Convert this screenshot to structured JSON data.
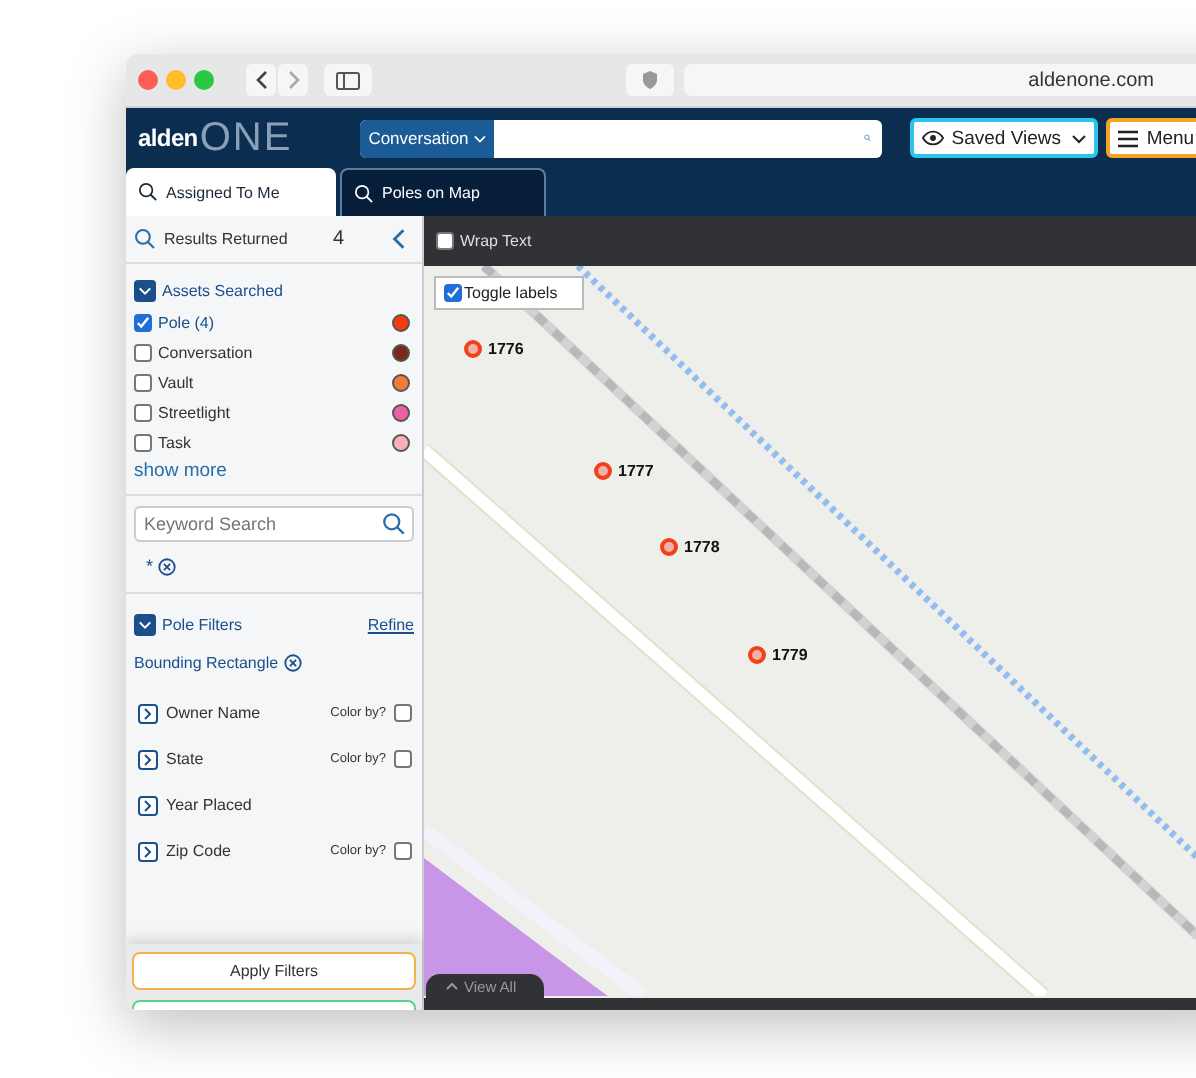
{
  "browser": {
    "url": "aldenone.com"
  },
  "header": {
    "logo": {
      "part_1": "alden",
      "part_2": "ONE"
    },
    "search": {
      "scope": "Conversation"
    },
    "saved_views": "Saved Views",
    "menu": "Menu"
  },
  "tabs": [
    {
      "label": "Assigned To Me",
      "selected": true
    },
    {
      "label": "Poles on Map",
      "selected": false
    }
  ],
  "sidebar": {
    "results": {
      "label": "Results Returned",
      "count": "4"
    },
    "assets": {
      "title": "Assets Searched",
      "expanded": true,
      "items": [
        {
          "label": "Pole (4)",
          "checked": true,
          "color": "#f23c0f"
        },
        {
          "label": "Conversation",
          "checked": false,
          "color": "#7a2a1a"
        },
        {
          "label": "Vault",
          "checked": false,
          "color": "#f07c38"
        },
        {
          "label": "Streetlight",
          "checked": false,
          "color": "#ee5fa3"
        },
        {
          "label": "Task",
          "checked": false,
          "color": "#f6b1b8"
        }
      ],
      "show_more": "show more"
    },
    "keyword_search": {
      "placeholder": "Keyword Search",
      "chip": "*"
    },
    "pole_filters": {
      "title": "Pole Filters",
      "expanded": true,
      "refine": "Refine",
      "bounding": "Bounding Rectangle",
      "filters": [
        {
          "label": "Owner Name",
          "color_by": "Color by?",
          "color_by_checked": false
        },
        {
          "label": "State",
          "color_by": "Color by?",
          "color_by_checked": false
        },
        {
          "label": "Year Placed"
        },
        {
          "label": "Zip Code",
          "color_by": "Color by?",
          "color_by_checked": false
        }
      ]
    },
    "apply": "Apply Filters"
  },
  "map": {
    "wrap_text": {
      "label": "Wrap Text",
      "checked": false
    },
    "toggle_labels": {
      "label": "Toggle labels",
      "checked": true
    },
    "markers": [
      {
        "label": "1776"
      },
      {
        "label": "1777"
      },
      {
        "label": "1778"
      },
      {
        "label": "1779"
      }
    ],
    "view_all": "View All"
  }
}
